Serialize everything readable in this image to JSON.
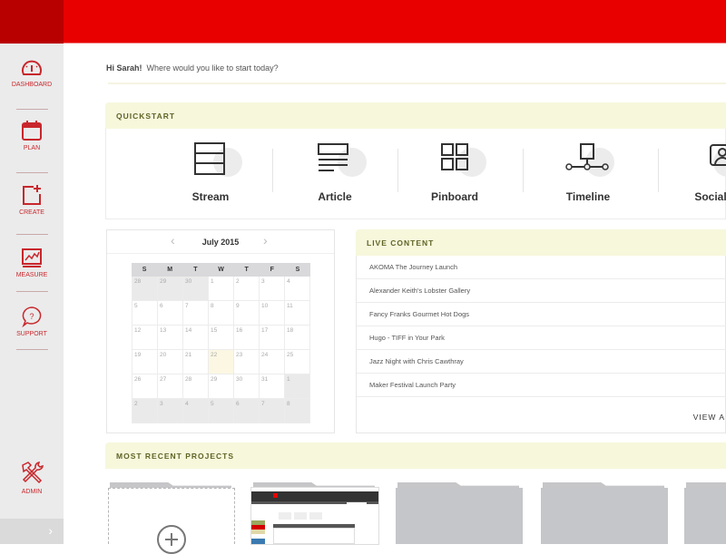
{
  "colors": {
    "brand": "#e80000",
    "brand_dark": "#b90000",
    "accent_text": "#c8272c",
    "panel_header": "#f7f7dc"
  },
  "sidebar": {
    "items": [
      {
        "label": "DASHBOARD",
        "icon": "speedometer-icon"
      },
      {
        "label": "PLAN",
        "icon": "calendar-icon"
      },
      {
        "label": "CREATE",
        "icon": "create-plus-icon"
      },
      {
        "label": "MEASURE",
        "icon": "chart-icon"
      },
      {
        "label": "SUPPORT",
        "icon": "question-bubble-icon"
      },
      {
        "label": "ADMIN",
        "icon": "tools-icon"
      }
    ],
    "toggle": "›"
  },
  "greeting": {
    "name": "Hi Sarah!",
    "message": "Where would you like to start today?"
  },
  "quickstart": {
    "title": "QUICKSTART",
    "items": [
      {
        "label": "Stream",
        "icon": "stream-icon"
      },
      {
        "label": "Article",
        "icon": "article-icon"
      },
      {
        "label": "Pinboard",
        "icon": "pinboard-icon"
      },
      {
        "label": "Timeline",
        "icon": "timeline-icon"
      },
      {
        "label": "Social",
        "icon": "social-icon"
      }
    ]
  },
  "calendar": {
    "month": "July 2015",
    "prev": "‹",
    "next": "›",
    "weekdays": [
      "S",
      "M",
      "T",
      "W",
      "T",
      "F",
      "S"
    ],
    "weeks": [
      [
        {
          "d": "28",
          "o": true
        },
        {
          "d": "29",
          "o": true
        },
        {
          "d": "30",
          "o": true
        },
        {
          "d": "1"
        },
        {
          "d": "2"
        },
        {
          "d": "3"
        },
        {
          "d": "4"
        }
      ],
      [
        {
          "d": "5"
        },
        {
          "d": "6"
        },
        {
          "d": "7"
        },
        {
          "d": "8"
        },
        {
          "d": "9"
        },
        {
          "d": "10"
        },
        {
          "d": "11"
        }
      ],
      [
        {
          "d": "12"
        },
        {
          "d": "13"
        },
        {
          "d": "14"
        },
        {
          "d": "15"
        },
        {
          "d": "16"
        },
        {
          "d": "17"
        },
        {
          "d": "18"
        }
      ],
      [
        {
          "d": "19"
        },
        {
          "d": "20"
        },
        {
          "d": "21"
        },
        {
          "d": "22",
          "t": true
        },
        {
          "d": "23"
        },
        {
          "d": "24"
        },
        {
          "d": "25"
        }
      ],
      [
        {
          "d": "26"
        },
        {
          "d": "27"
        },
        {
          "d": "28"
        },
        {
          "d": "29"
        },
        {
          "d": "30"
        },
        {
          "d": "31"
        },
        {
          "d": "1",
          "o": true
        }
      ],
      [
        {
          "d": "2",
          "o": true
        },
        {
          "d": "3",
          "o": true
        },
        {
          "d": "4",
          "o": true
        },
        {
          "d": "5",
          "o": true
        },
        {
          "d": "6",
          "o": true
        },
        {
          "d": "7",
          "o": true
        },
        {
          "d": "8",
          "o": true
        }
      ]
    ],
    "today": "22"
  },
  "live_content": {
    "title": "LIVE CONTENT",
    "items": [
      "AKOMA The Journey Launch",
      "Alexander Keith's Lobster Gallery",
      "Fancy Franks Gourmet Hot Dogs",
      "Hugo - TIFF in Your Park",
      "Jazz Night with Chris Cawthray",
      "Maker Festival Launch Party"
    ],
    "view_all": "VIEW A"
  },
  "recent_projects": {
    "title": "MOST RECENT PROJECTS",
    "new_project_icon": "add-circle-icon"
  }
}
